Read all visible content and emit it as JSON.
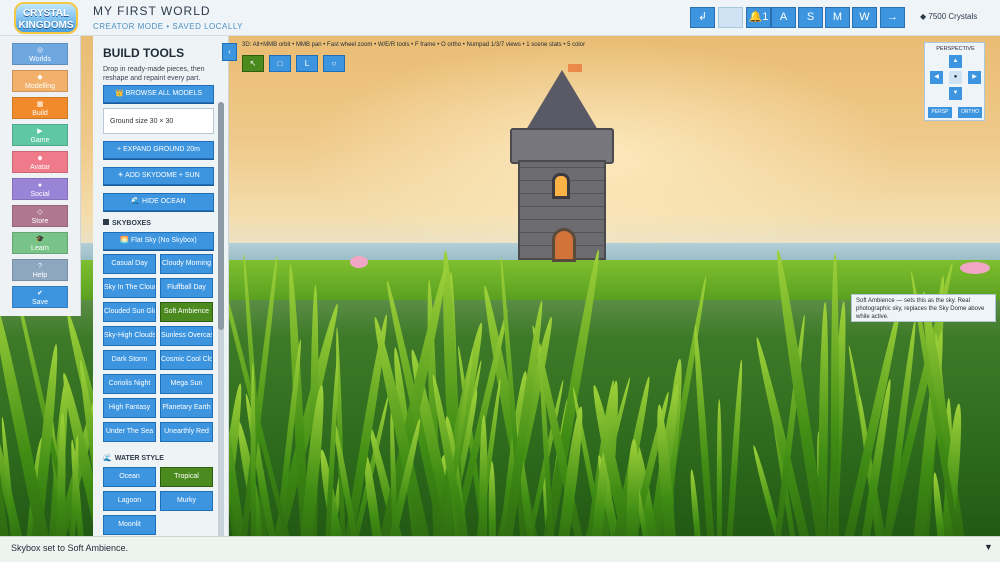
{
  "header": {
    "logo_text": "CRYSTAL KINGDOMS",
    "world_title": "MY FIRST WORLD",
    "world_subtitle": "CREATOR MODE  •  SAVED LOCALLY",
    "buttons": [
      "↲",
      "",
      "🔔1",
      "A",
      "S",
      "M",
      "W",
      "→"
    ],
    "crystals": "7500 Crystals"
  },
  "nav": {
    "items": [
      {
        "icon": "◎",
        "label": "Worlds",
        "color": "#6fa7e0"
      },
      {
        "icon": "◆",
        "label": "Modelling",
        "color": "#f2b06a"
      },
      {
        "icon": "▦",
        "label": "Build",
        "color": "#f08a2a"
      },
      {
        "icon": "▶",
        "label": "Game",
        "color": "#5fc7a4"
      },
      {
        "icon": "☻",
        "label": "Avatar",
        "color": "#ef7a8a"
      },
      {
        "icon": "●",
        "label": "Social",
        "color": "#9a84d8"
      },
      {
        "icon": "◇",
        "label": "Store",
        "color": "#b07890"
      },
      {
        "icon": "🎓",
        "label": "Learn",
        "color": "#78c488"
      },
      {
        "icon": "?",
        "label": "Help",
        "color": "#8da7c0"
      },
      {
        "icon": "✔",
        "label": "Save",
        "color": "#3d95e0"
      }
    ]
  },
  "panel": {
    "title": "BUILD TOOLS",
    "description": "Drop in ready-made pieces, then reshape and repaint every part.",
    "browse": "👑 BROWSE ALL MODELS",
    "ground_size": "Ground size  30 × 30",
    "expand_ground": "+ EXPAND GROUND 20m",
    "add_skydome": "☀ ADD SKYDOME + SUN",
    "hide_ocean": "🌊 HIDE OCEAN",
    "skyboxes_title": "SKYBOXES",
    "flat_sky": "🌅 Flat Sky (No Skybox)",
    "skyboxes": [
      {
        "label": "Casual Day",
        "selected": false
      },
      {
        "label": "Cloudy Morning",
        "selected": false
      },
      {
        "label": "Sky In The Clouds",
        "selected": false
      },
      {
        "label": "Fluffball Day",
        "selected": false
      },
      {
        "label": "Clouded Sun Glow",
        "selected": false
      },
      {
        "label": "Soft Ambience",
        "selected": true
      },
      {
        "label": "Sky-High Clouds",
        "selected": false
      },
      {
        "label": "Sunless Overcast",
        "selected": false
      },
      {
        "label": "Dark Storm",
        "selected": false
      },
      {
        "label": "Cosmic Cool Cloud",
        "selected": false
      },
      {
        "label": "Coriolis Night",
        "selected": false
      },
      {
        "label": "Mega Sun",
        "selected": false
      },
      {
        "label": "High Fantasy",
        "selected": false
      },
      {
        "label": "Planetary Earth",
        "selected": false
      },
      {
        "label": "Under The Sea",
        "selected": false
      },
      {
        "label": "Unearthly Red",
        "selected": false
      }
    ],
    "water_title": "WATER STYLE",
    "water": [
      {
        "label": "Ocean",
        "selected": false
      },
      {
        "label": "Tropical",
        "selected": true
      },
      {
        "label": "Lagoon",
        "selected": false
      },
      {
        "label": "Murky",
        "selected": false
      },
      {
        "label": "Moonlit",
        "selected": false
      }
    ]
  },
  "viewport": {
    "collapse": "‹",
    "help_line": "3D: Alt+MMB orbit • MMB pan • Fast wheel zoom • W/E/R tools • F frame • O ortho • Numpad 1/3/7 views • 1 scene stats • 5 color",
    "tools": [
      {
        "icon": "↖",
        "selected": true
      },
      {
        "icon": "□",
        "selected": false
      },
      {
        "icon": "L",
        "selected": false
      },
      {
        "icon": "○",
        "selected": false
      }
    ]
  },
  "perspective": {
    "title": "PERSPECTIVE",
    "up": "▲",
    "down": "▼",
    "left": "◀",
    "right": "▶",
    "center": "●",
    "persp": "PERSP",
    "ortho": "ORTHO"
  },
  "tooltip": "Soft Ambience — sets this as the sky. Real photographic sky, replaces the Sky Dome above while active.",
  "status": {
    "text": "Skybox set to Soft Ambience.",
    "toggle": "▼"
  }
}
